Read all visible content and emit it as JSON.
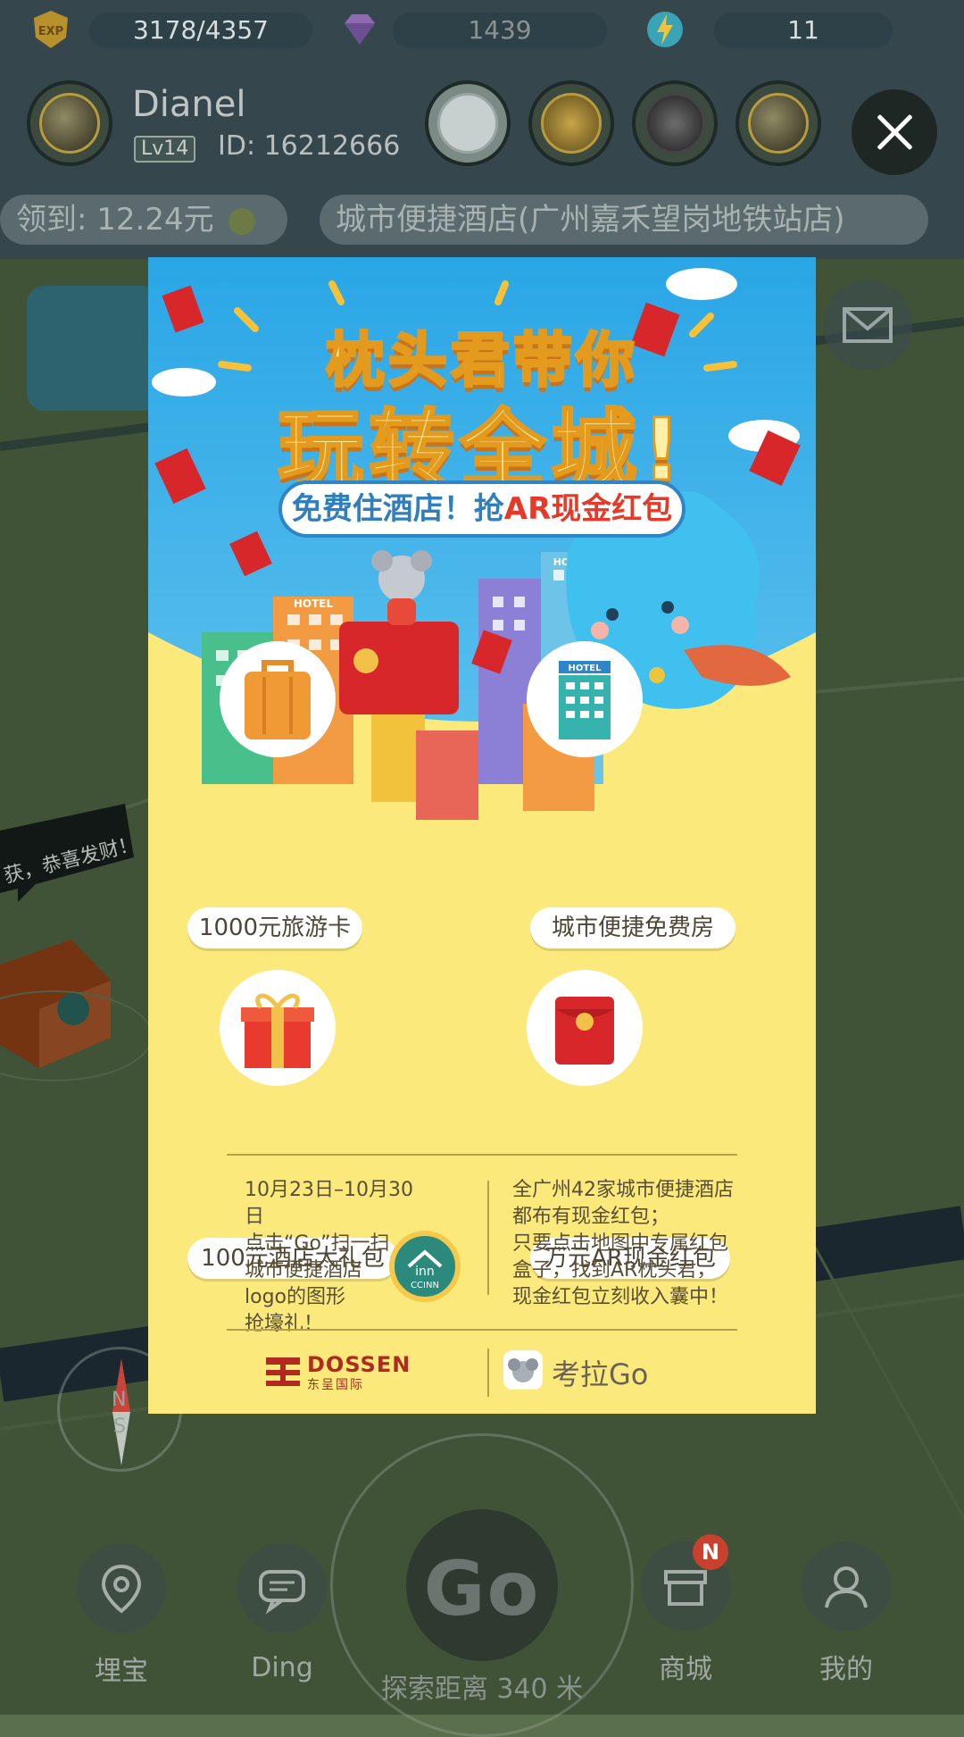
{
  "status_bar": {
    "exp_icon": "EXP",
    "exp_value": "3178/4357",
    "gem_value": "1439",
    "energy_value": "11"
  },
  "user": {
    "name": "Dianel",
    "level": "Lv14",
    "id_text": "ID: 16212666"
  },
  "notifications": {
    "received_text": "领到: 12.24元",
    "location_text": "城市便捷酒店(广州嘉禾望岗地铁站店)"
  },
  "map_labels": {
    "bubble_text": "获，恭喜发财！"
  },
  "poster": {
    "title_line1": "枕头君带你",
    "title_line2": "玩转全城!",
    "subtitle_prefix": "免费住酒店！抢",
    "subtitle_highlight": "AR现金红包",
    "hotel_sign": "HOTEL",
    "prizes": [
      {
        "label": "1000元旅游卡",
        "icon": "suitcase-icon"
      },
      {
        "label": "城市便捷免费房",
        "icon": "hotel-icon"
      },
      {
        "label": "100元酒店大礼包",
        "icon": "gift-box-icon"
      },
      {
        "label": "万元AR现金红包",
        "icon": "red-envelope-icon"
      }
    ],
    "left_info": "10月23日–10月30日\n点击“Go”扫一扫\n城市便捷酒店\nlogo的图形\n抢壕礼！",
    "right_info": "全广州42家城市便捷酒店\n都布有现金红包；\n只要点击地图中专属红包\n盒子，找到AR枕头君，\n现金红包立刻收入囊中！",
    "ccinn_text": "CCINN",
    "ccinn_mark": "inn",
    "dossen_en": "DOSSEN",
    "dossen_cn": "东呈国际",
    "koala_brand": "考拉Go"
  },
  "bottom_nav": {
    "items": [
      {
        "label": "埋宝",
        "icon": "map-pin-icon"
      },
      {
        "label": "Ding",
        "icon": "chat-icon"
      },
      {
        "label": "商城",
        "icon": "shop-icon"
      },
      {
        "label": "我的",
        "icon": "profile-icon"
      }
    ],
    "go_label": "Go",
    "explore_text": "探索距离 340 米",
    "shop_badge": "N"
  },
  "compass": {
    "north": "N",
    "south": "S"
  },
  "colors": {
    "sky_blue": "#2aa6e6",
    "poster_yellow": "#fbe97c",
    "red_envelope": "#d7272a",
    "title_orange": "#e39a1d"
  }
}
